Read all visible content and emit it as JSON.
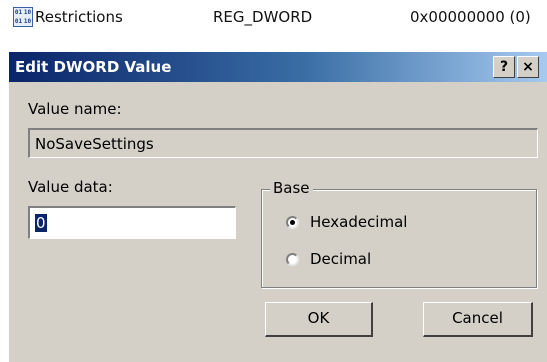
{
  "registry_row": {
    "icon": "registry-binary-icon",
    "icon_glyphs": [
      "01",
      "10",
      "01",
      "10"
    ],
    "name": "Restrictions",
    "type": "REG_DWORD",
    "data": "0x00000000 (0)"
  },
  "dialog": {
    "title": "Edit DWORD Value",
    "help_button": "?",
    "close_button": "×",
    "value_name_label": "Value name:",
    "value_name": "NoSaveSettings",
    "value_data_label": "Value data:",
    "value_data": "0",
    "base": {
      "title": "Base",
      "options": [
        "Hexadecimal",
        "Decimal"
      ],
      "selected": "Hexadecimal"
    },
    "ok_label": "OK",
    "cancel_label": "Cancel"
  },
  "colors": {
    "title_gradient_start": "#0a246a",
    "title_gradient_end": "#a6caf0",
    "dialog_face": "#d4d0c8",
    "selection": "#0a246a"
  }
}
